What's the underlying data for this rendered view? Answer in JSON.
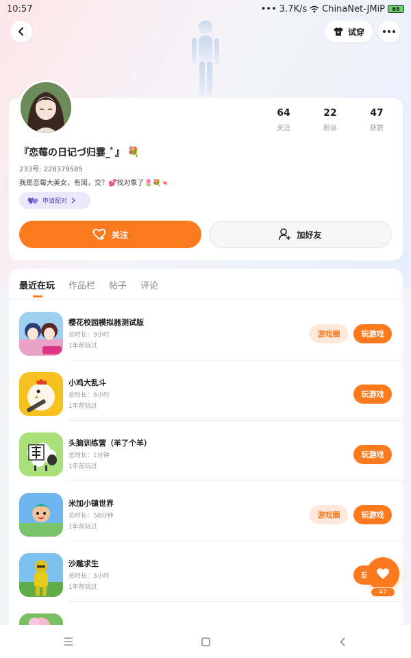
{
  "status_bar": {
    "time": "10:57",
    "speed": "3.7K/s",
    "network": "ChinaNet-JMiP",
    "battery": "65"
  },
  "header": {
    "tryon_label": "试穿"
  },
  "profile": {
    "nickname": "『恋莓の日记づ归霎_ﾟ』",
    "uid": "233号: 228379585",
    "bio": "我是恋莓大美女，有闺，交？💕找对象了🌷💐🍬",
    "match_label": "申请配对",
    "stats": [
      {
        "value": "64",
        "label": "关注"
      },
      {
        "value": "22",
        "label": "粉丝"
      },
      {
        "value": "47",
        "label": "获赞"
      }
    ],
    "follow_label": "关注",
    "addfriend_label": "加好友"
  },
  "tabs": [
    {
      "label": "最近在玩",
      "active": true
    },
    {
      "label": "作品栏",
      "active": false
    },
    {
      "label": "帖子",
      "active": false
    },
    {
      "label": "评论",
      "active": false
    }
  ],
  "games": [
    {
      "title": "樱花校园模拟器测试版",
      "duration": "总时长：9小时",
      "last_played": "1年前玩过",
      "circle_label": "游戏圈",
      "play_label": "玩游戏",
      "icon": "sakura-school-icon"
    },
    {
      "title": "小鸡大乱斗",
      "duration": "总时长：6小时",
      "last_played": "1年前玩过",
      "play_label": "玩游戏",
      "icon": "chicken-gun-icon"
    },
    {
      "title": "头脑训练营（羊了个羊）",
      "duration": "总时长：1分钟",
      "last_played": "1年前玩过",
      "play_label": "玩游戏",
      "icon": "sheep-icon"
    },
    {
      "title": "米加小镇世界",
      "duration": "总时长：58分钟",
      "last_played": "1年前玩过",
      "circle_label": "游戏圈",
      "play_label": "玩游戏",
      "icon": "toca-world-icon"
    },
    {
      "title": "沙雕求生",
      "duration": "总时长：3小时",
      "last_played": "1年前玩过",
      "play_label": "玩游戏",
      "icon": "survival-icon"
    }
  ],
  "like_fab": {
    "count": "47"
  },
  "colors": {
    "accent": "#fc7a1e",
    "match_bg": "#ebe8fb"
  }
}
